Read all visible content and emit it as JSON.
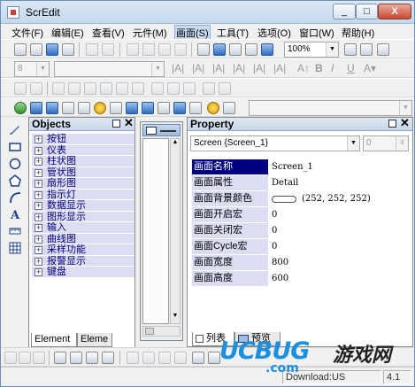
{
  "window": {
    "title": "ScrEdit",
    "min_glyph": "_",
    "max_glyph": "□",
    "close_glyph": "X"
  },
  "menu": [
    "文件(F)",
    "编辑(E)",
    "查看(V)",
    "元件(M)",
    "画面(S)",
    "工具(T)",
    "选项(O)",
    "窗口(W)",
    "帮助(H)"
  ],
  "menu_active": "画面(S)",
  "toolbar1": {
    "zoom_value": "100%"
  },
  "toolbar2": {
    "font_size": "8"
  },
  "objects_panel": {
    "title": "Objects",
    "items": [
      "按钮",
      "仪表",
      "柱状图",
      "管状图",
      "扇形图",
      "指示灯",
      "数据显示",
      "图形显示",
      "输入",
      "曲线图",
      "采样功能",
      "报警显示",
      "键盘"
    ],
    "tabs": [
      "Element",
      "Eleme"
    ]
  },
  "property_panel": {
    "title": "Property",
    "selector": "Screen {Screen_1}",
    "spin_value": "0",
    "rows": [
      {
        "name": "画面名称",
        "value": "Screen_1"
      },
      {
        "name": "画面属性",
        "value": "Detail"
      },
      {
        "name": "画面背景颜色",
        "value": "(252, 252, 252)",
        "swatch": "#fcfcfc"
      },
      {
        "name": "画面开启宏",
        "value": "0"
      },
      {
        "name": "画面关闭宏",
        "value": "0"
      },
      {
        "name": "画面Cycle宏",
        "value": "0"
      },
      {
        "name": "画面宽度",
        "value": "800"
      },
      {
        "name": "画面高度",
        "value": "600"
      }
    ],
    "tabs": [
      "列表",
      "预览"
    ]
  },
  "status": {
    "text": "Download:US",
    "version": "4.1"
  },
  "watermark": {
    "brand": "UCBUG",
    "cn": "游戏网",
    "domain": ".com"
  },
  "colors": {
    "selection": "#000080",
    "row_bg": "#dcdcf3",
    "accent": "#1d8fe0"
  }
}
